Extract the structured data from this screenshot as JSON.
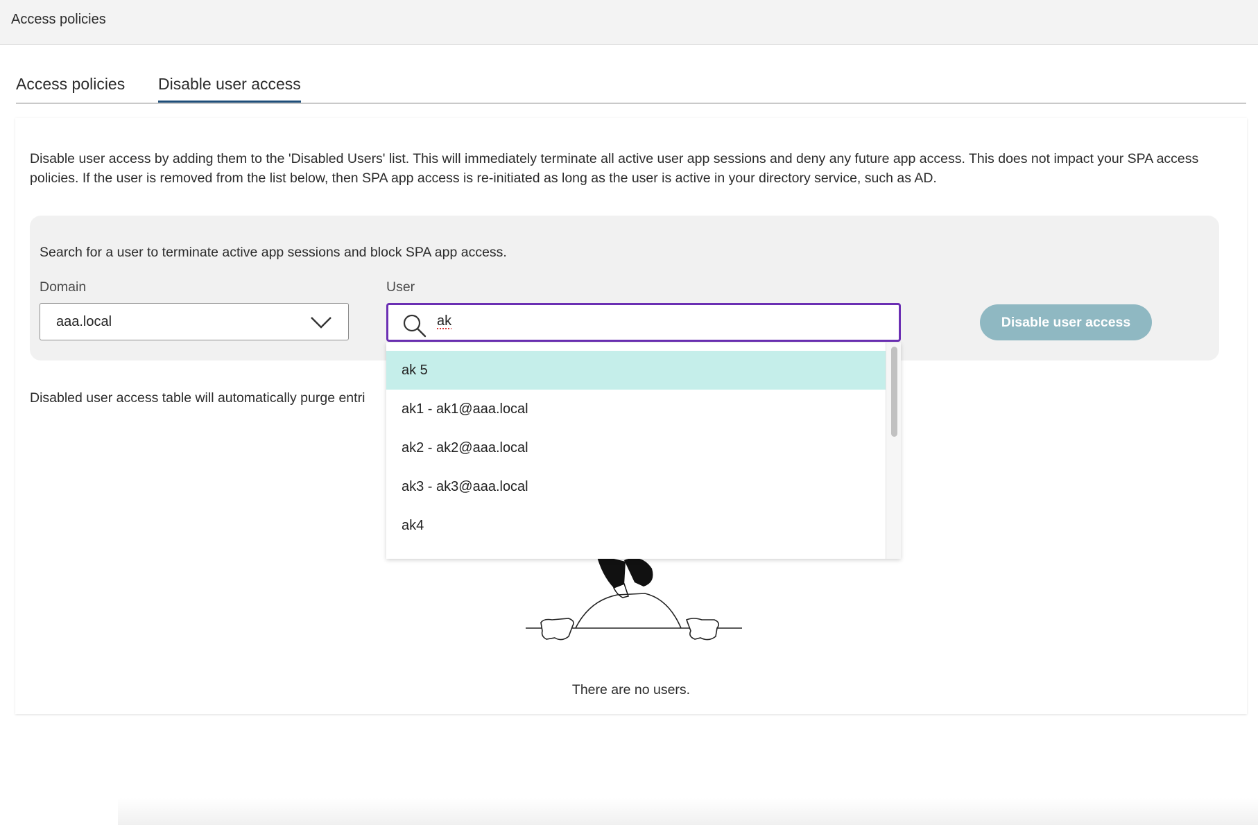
{
  "header": {
    "title": "Access policies"
  },
  "tabs": [
    {
      "label": "Access policies",
      "active": false
    },
    {
      "label": "Disable user access",
      "active": true
    }
  ],
  "description": "Disable user access by adding them to the 'Disabled Users' list. This will immediately terminate all active user app sessions and deny any future app access. This does not impact your SPA access policies. If the user is removed from the list below, then SPA app access is re-initiated as long as the user is active in your directory service, such as AD.",
  "search_panel": {
    "hint": "Search for a user to terminate active app sessions and block SPA app access.",
    "domain_label": "Domain",
    "domain_value": "aaa.local",
    "user_label": "User",
    "user_value": "ak",
    "button_label": "Disable user access"
  },
  "dropdown": {
    "items": [
      {
        "label": "ak 5",
        "selected": true
      },
      {
        "label": "ak1 - ak1@aaa.local",
        "selected": false
      },
      {
        "label": "ak2 - ak2@aaa.local",
        "selected": false
      },
      {
        "label": "ak3 - ak3@aaa.local",
        "selected": false
      },
      {
        "label": "ak4",
        "selected": false
      }
    ]
  },
  "purge_text": "Disabled user access table will automatically purge entri",
  "empty_state": {
    "message": "There are no users."
  },
  "colors": {
    "accent_focus": "#6b2fb3",
    "button_disabled": "#8fb8c2",
    "selected_item": "#c5eeea",
    "tab_underline": "#1f4e79"
  }
}
